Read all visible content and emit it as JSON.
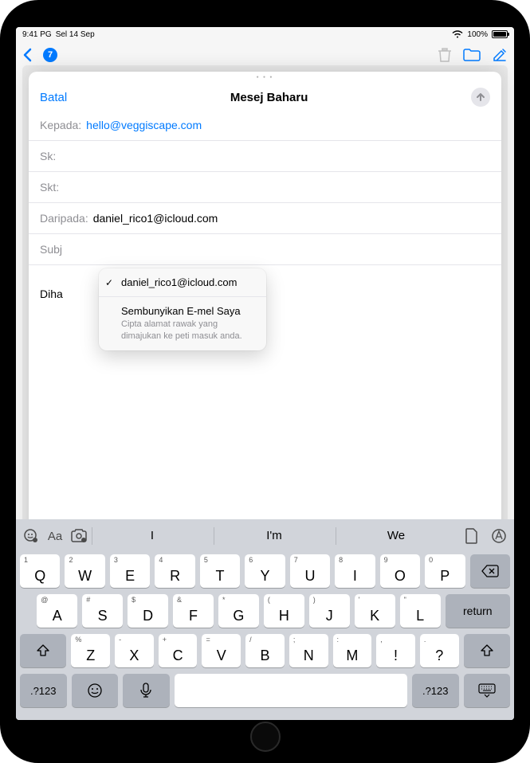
{
  "status": {
    "time": "9:41 PG",
    "date": "Sel 14 Sep",
    "wifi": "wifi",
    "battery_pct": "100%"
  },
  "nav": {
    "badge": "7"
  },
  "compose": {
    "cancel": "Batal",
    "title": "Mesej Baharu",
    "to_label": "Kepada:",
    "to_value": "hello@veggiscape.com",
    "cc_label": "Sk:",
    "bcc_label": "Skt:",
    "from_label": "Daripada:",
    "from_value": "daniel_rico1@icloud.com",
    "subject_label": "Subj",
    "body": "Diha"
  },
  "popover": {
    "selected": "daniel_rico1@icloud.com",
    "hide_title": "Sembunyikan E-mel Saya",
    "hide_desc": "Cipta alamat rawak yang dimajukan ke peti masuk anda."
  },
  "keyboard": {
    "suggestions": [
      "I",
      "I'm",
      "We"
    ],
    "row1": [
      {
        "k": "Q",
        "h": "1"
      },
      {
        "k": "W",
        "h": "2"
      },
      {
        "k": "E",
        "h": "3"
      },
      {
        "k": "R",
        "h": "4"
      },
      {
        "k": "T",
        "h": "5"
      },
      {
        "k": "Y",
        "h": "6"
      },
      {
        "k": "U",
        "h": "7"
      },
      {
        "k": "I",
        "h": "8"
      },
      {
        "k": "O",
        "h": "9"
      },
      {
        "k": "P",
        "h": "0"
      }
    ],
    "row2": [
      {
        "k": "A",
        "h": "@"
      },
      {
        "k": "S",
        "h": "#"
      },
      {
        "k": "D",
        "h": "$"
      },
      {
        "k": "F",
        "h": "&"
      },
      {
        "k": "G",
        "h": "*"
      },
      {
        "k": "H",
        "h": "("
      },
      {
        "k": "J",
        "h": ")"
      },
      {
        "k": "K",
        "h": "'"
      },
      {
        "k": "L",
        "h": "\""
      }
    ],
    "row3": [
      {
        "k": "Z",
        "h": "%"
      },
      {
        "k": "X",
        "h": "-"
      },
      {
        "k": "C",
        "h": "+"
      },
      {
        "k": "V",
        "h": "="
      },
      {
        "k": "B",
        "h": "/"
      },
      {
        "k": "N",
        "h": ";"
      },
      {
        "k": "M",
        "h": ":"
      },
      {
        "k": "!",
        "h": ","
      },
      {
        "k": "?",
        "h": "."
      }
    ],
    "return": "return",
    "numkey": ".?123"
  }
}
